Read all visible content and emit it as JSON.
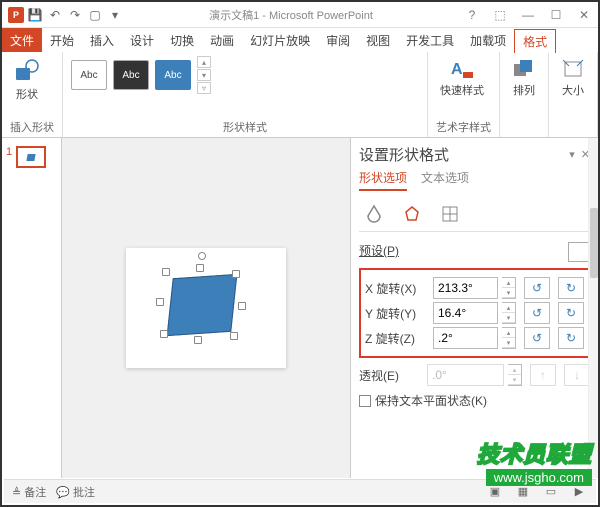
{
  "title": "演示文稿1 - Microsoft PowerPoint",
  "qat": {
    "save": "💾",
    "undo": "↶",
    "redo": "↷",
    "slideshow": "▢",
    "more": "▾"
  },
  "winctrl": {
    "help": "?",
    "opts": "⬚",
    "min": "—",
    "max": "☐",
    "close": "✕"
  },
  "tabs": [
    "文件",
    "开始",
    "插入",
    "设计",
    "切换",
    "动画",
    "幻灯片放映",
    "审阅",
    "视图",
    "开发工具",
    "加载项",
    "格式"
  ],
  "tabs_active": 11,
  "ribbon": {
    "g1": {
      "btn": "形状",
      "label": "插入形状"
    },
    "g2": {
      "a": "Abc",
      "label": "形状样式"
    },
    "g3": {
      "btn": "快速样式",
      "label": "艺术字样式"
    },
    "g4": {
      "btn": "排列"
    },
    "g5": {
      "btn": "大小"
    }
  },
  "thumb_num": "1",
  "pane": {
    "title": "设置形状格式",
    "subtabs": {
      "shape": "形状选项",
      "text": "文本选项"
    },
    "preset": "预设(P)",
    "xrot": {
      "label": "X 旋转(X)",
      "value": "213.3°"
    },
    "yrot": {
      "label": "Y 旋转(Y)",
      "value": "16.4°"
    },
    "zrot": {
      "label": "Z 旋转(Z)",
      "value": ".2°"
    },
    "persp": {
      "label": "透视(E)",
      "value": ".0°"
    },
    "keepflat": "保持文本平面状态(K)"
  },
  "status": {
    "notes": "备注",
    "comments": "批注"
  },
  "wm": {
    "line1": "技术员联盟",
    "line2": "www.jsgho.com"
  }
}
